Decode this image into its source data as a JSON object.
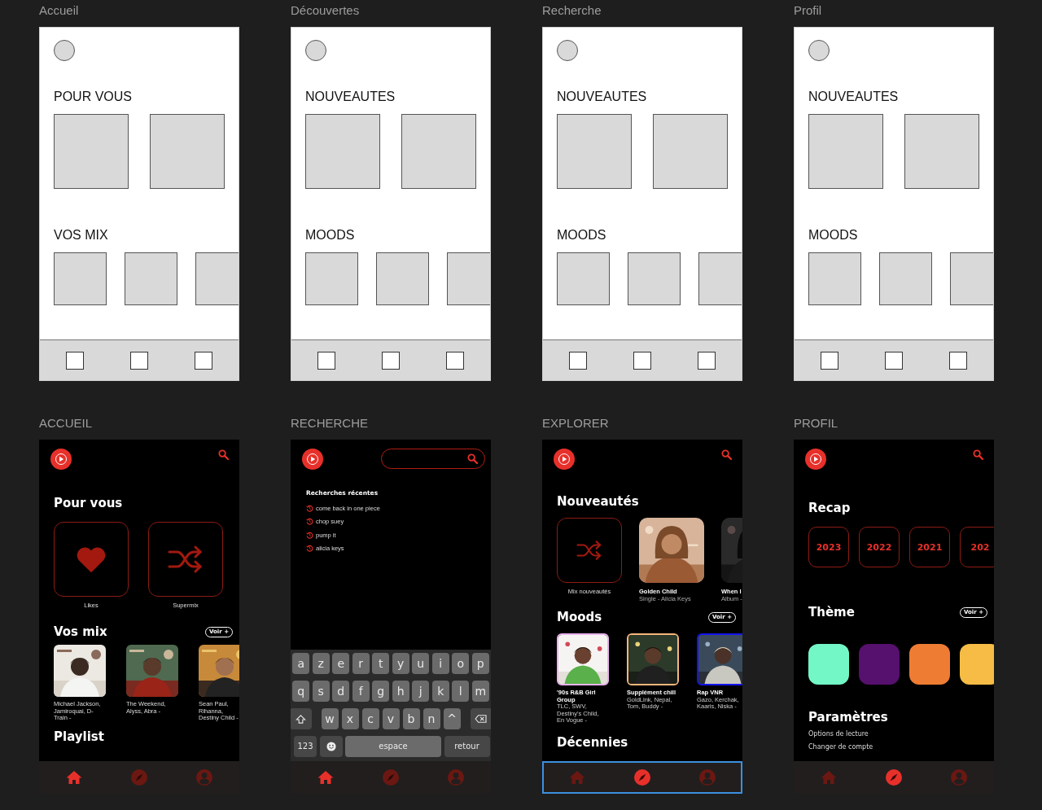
{
  "wireframes": [
    {
      "label": "Accueil",
      "sections": [
        "POUR VOUS",
        "VOS MIX"
      ]
    },
    {
      "label": "Découvertes",
      "sections": [
        "NOUVEAUTES",
        "MOODS"
      ]
    },
    {
      "label": "Recherche",
      "sections": [
        "NOUVEAUTES",
        "MOODS"
      ]
    },
    {
      "label": "Profil",
      "sections": [
        "NOUVEAUTES",
        "MOODS"
      ]
    }
  ],
  "mockups": [
    {
      "label": "ACCUEIL",
      "kind": "feed",
      "outlined": false,
      "sections": [
        {
          "kind": "tiles",
          "title": "Pour vous",
          "items": [
            {
              "kind": "heart",
              "caption": "Likes"
            },
            {
              "kind": "shuffle",
              "caption": "Supermix"
            }
          ]
        },
        {
          "kind": "mixes",
          "title": "Vos mix",
          "action": "Voir +",
          "items": [
            {
              "caption": "Michael Jackson, Jamiroquai, D-Train -"
            },
            {
              "caption": "The Weekend, Alyss, Abra -"
            },
            {
              "caption": "Sean Paul, Rihanna, Destiny Child -"
            }
          ]
        },
        {
          "kind": "heading",
          "title": "Playlist"
        }
      ],
      "nav": [
        {
          "kind": "home",
          "selected": true
        },
        {
          "kind": "compass",
          "selected": false
        },
        {
          "kind": "profile",
          "selected": false
        }
      ]
    },
    {
      "label": "RECHERCHE",
      "kind": "search",
      "outlined": false,
      "recent": {
        "title": "Recherches récentes",
        "items": [
          "come back in one piece",
          "chop suey",
          "pump it",
          "alicia keys"
        ]
      },
      "keyboard": [
        [
          {
            "kind": "letter",
            "label": "a"
          },
          {
            "kind": "letter",
            "label": "z"
          },
          {
            "kind": "letter",
            "label": "e"
          },
          {
            "kind": "letter",
            "label": "r"
          },
          {
            "kind": "letter",
            "label": "t"
          },
          {
            "kind": "letter",
            "label": "y"
          },
          {
            "kind": "letter",
            "label": "u"
          },
          {
            "kind": "letter",
            "label": "i"
          },
          {
            "kind": "letter",
            "label": "o"
          },
          {
            "kind": "letter",
            "label": "p"
          }
        ],
        [
          {
            "kind": "letter",
            "label": "q"
          },
          {
            "kind": "letter",
            "label": "s"
          },
          {
            "kind": "letter",
            "label": "d"
          },
          {
            "kind": "letter",
            "label": "f"
          },
          {
            "kind": "letter",
            "label": "g"
          },
          {
            "kind": "letter",
            "label": "h"
          },
          {
            "kind": "letter",
            "label": "j"
          },
          {
            "kind": "letter",
            "label": "k"
          },
          {
            "kind": "letter",
            "label": "l"
          },
          {
            "kind": "letter",
            "label": "m"
          }
        ],
        [
          {
            "kind": "shift"
          },
          {
            "kind": "letter",
            "label": "w"
          },
          {
            "kind": "letter",
            "label": "x"
          },
          {
            "kind": "letter",
            "label": "c"
          },
          {
            "kind": "letter",
            "label": "v"
          },
          {
            "kind": "letter",
            "label": "b"
          },
          {
            "kind": "letter",
            "label": "n"
          },
          {
            "kind": "letter",
            "label": "^"
          },
          {
            "kind": "backspace"
          }
        ],
        [
          {
            "kind": "function",
            "label": "123"
          },
          {
            "kind": "emoji"
          },
          {
            "kind": "space",
            "label": "espace"
          },
          {
            "kind": "function",
            "label": "retour"
          }
        ]
      ],
      "nav": [
        {
          "kind": "home",
          "selected": true
        },
        {
          "kind": "compass",
          "selected": false
        },
        {
          "kind": "profile",
          "selected": false
        }
      ]
    },
    {
      "label": "EXPLORER",
      "kind": "feed",
      "outlined": true,
      "sections": [
        {
          "kind": "covers",
          "title": "Nouveautés",
          "items": [
            {
              "kind": "shuffle",
              "caption": "Mix nouveautés"
            },
            {
              "kind": "picture",
              "title": "Golden Child",
              "subtitle": "Single - Alicia Keys"
            },
            {
              "kind": "picture",
              "title": "When I",
              "subtitle": "Album -"
            }
          ]
        },
        {
          "kind": "moods",
          "title": "Moods",
          "action": "Voir +",
          "items": [
            {
              "title": "'90s R&B Girl Group",
              "subtitle": "TLC, SWV, Destiny's Child, En Vogue -",
              "color": "#e9b3ee"
            },
            {
              "title": "Supplément chill",
              "subtitle": "GoldLink, Nepal, Tom, Buddy -",
              "color": "#f5b77c"
            },
            {
              "title": "Rap VNR",
              "subtitle": "Gazo, Kerchak, Kaaris, Niska -",
              "color": "#1414f0"
            }
          ]
        },
        {
          "kind": "heading",
          "title": "Décennies"
        }
      ],
      "nav": [
        {
          "kind": "home",
          "selected": false
        },
        {
          "kind": "compass",
          "selected": true
        },
        {
          "kind": "profile",
          "selected": false
        }
      ]
    },
    {
      "label": "PROFIL",
      "kind": "feed",
      "outlined": false,
      "sections": [
        {
          "kind": "years",
          "title": "Recap",
          "items": [
            "2023",
            "2022",
            "2021",
            "202"
          ]
        },
        {
          "kind": "swatches",
          "title": "Thème",
          "action": "Voir +",
          "items": [
            {
              "color": "#74f7c6"
            },
            {
              "color": "#56106e"
            },
            {
              "color": "#ee7c33"
            },
            {
              "color": "#f6bc45"
            }
          ]
        },
        {
          "kind": "links",
          "title": "Paramètres",
          "items": [
            "Options de lecture",
            "Changer de compte"
          ]
        }
      ],
      "nav": [
        {
          "kind": "home",
          "selected": false
        },
        {
          "kind": "compass",
          "selected": true
        },
        {
          "kind": "profile",
          "selected": false
        }
      ]
    }
  ]
}
